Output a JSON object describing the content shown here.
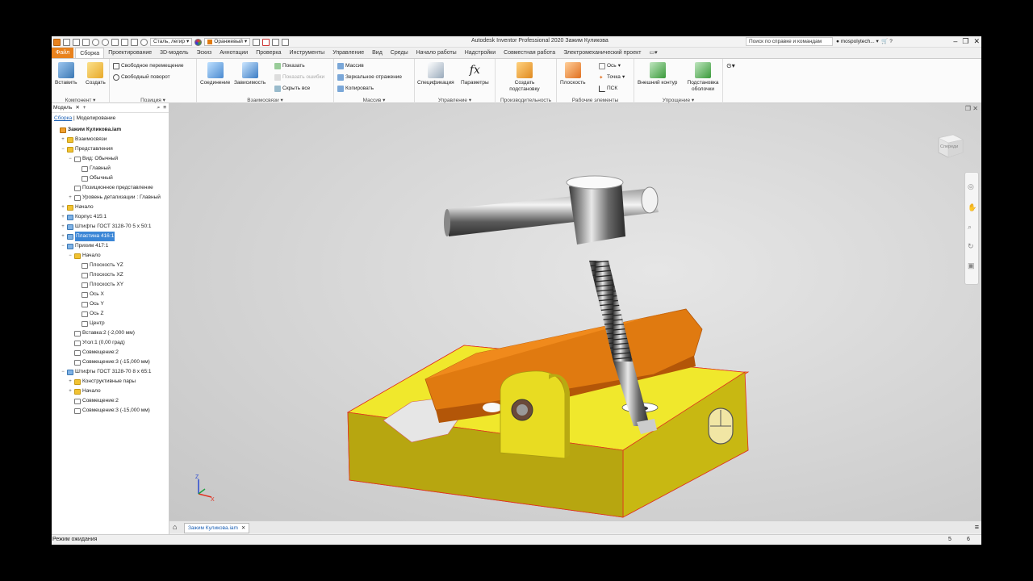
{
  "titlebar": {
    "material": "Сталь, легир",
    "appearance": "Оранжевый",
    "app_title": "Autodesk Inventor Professional 2020   Зажим Куликова",
    "search_placeholder": "Поиск по справке и командам",
    "user": "mospolytech..."
  },
  "tabs": [
    "Сборка",
    "Проектирование",
    "3D-модель",
    "Эскиз",
    "Аннотации",
    "Проверка",
    "Инструменты",
    "Управление",
    "Вид",
    "Среды",
    "Начало работы",
    "Надстройки",
    "Совместная работа",
    "Электромеханический проект"
  ],
  "file_tab": "Файл",
  "ribbon": {
    "component": {
      "label": "Компонент",
      "insert": "Вставить",
      "create": "Создать"
    },
    "position": {
      "label": "Позиция",
      "free_move": "Свободное перемещение",
      "free_rotate": "Свободный поворот"
    },
    "relations": {
      "label": "Взаимосвязи",
      "joint": "Соединение",
      "constraint": "Зависимость",
      "show": "Показать",
      "show_errors": "Показать ошибки",
      "hide_all": "Скрыть все"
    },
    "pattern": {
      "label": "Массив",
      "pattern": "Массив",
      "mirror": "Зеркальное отражение",
      "copy": "Копировать"
    },
    "manage": {
      "label": "Управление",
      "bom": "Спецификация",
      "params": "Параметры"
    },
    "productivity": {
      "label": "Производительность",
      "create_sub": "Создать подстановку"
    },
    "work_features": {
      "label": "Рабочие элементы",
      "plane": "Плоскость",
      "axis": "Ось",
      "point": "Точка",
      "ucs": "ПСК"
    },
    "simplify": {
      "label": "Упрощение",
      "shrinkwrap": "Внешний контур",
      "sub_shell": "Подстановка оболочки"
    }
  },
  "browser": {
    "title": "Модель",
    "crumb_link": "Сборка",
    "crumb_rest": "Моделирование",
    "items": [
      {
        "t": "Зажим Куликова.iam",
        "lvl": 0,
        "icon": "asm",
        "bold": true
      },
      {
        "t": "Взаимосвязи",
        "lvl": 1,
        "icon": "fold",
        "tg": "+"
      },
      {
        "t": "Представления",
        "lvl": 1,
        "icon": "fold",
        "tg": "−"
      },
      {
        "t": "Вид: Обычный",
        "lvl": 2,
        "icon": "gen",
        "tg": "−"
      },
      {
        "t": "Главный",
        "lvl": 3,
        "icon": "gen"
      },
      {
        "t": "Обычный",
        "lvl": 3,
        "icon": "gen"
      },
      {
        "t": "Позиционное представление",
        "lvl": 2,
        "icon": "gen"
      },
      {
        "t": "Уровень детализации : Главный",
        "lvl": 2,
        "icon": "gen",
        "tg": "+"
      },
      {
        "t": "Начало",
        "lvl": 1,
        "icon": "fold",
        "tg": "+"
      },
      {
        "t": "Корпус 415:1",
        "lvl": 1,
        "icon": "part",
        "tg": "+"
      },
      {
        "t": "Штифты ГОСТ 3128-70 5 х  50:1",
        "lvl": 1,
        "icon": "part",
        "tg": "+"
      },
      {
        "t": "Пластина 416:1",
        "lvl": 1,
        "icon": "part",
        "tg": "+",
        "sel": true
      },
      {
        "t": "Прихим 417:1",
        "lvl": 1,
        "icon": "part",
        "tg": "−"
      },
      {
        "t": "Начало",
        "lvl": 2,
        "icon": "fold",
        "tg": "−"
      },
      {
        "t": "Плоскость YZ",
        "lvl": 3,
        "icon": "gen"
      },
      {
        "t": "Плоскость XZ",
        "lvl": 3,
        "icon": "gen"
      },
      {
        "t": "Плоскость XY",
        "lvl": 3,
        "icon": "gen"
      },
      {
        "t": "Ось X",
        "lvl": 3,
        "icon": "gen"
      },
      {
        "t": "Ось Y",
        "lvl": 3,
        "icon": "gen"
      },
      {
        "t": "Ось Z",
        "lvl": 3,
        "icon": "gen"
      },
      {
        "t": "Центр",
        "lvl": 3,
        "icon": "gen"
      },
      {
        "t": "Вставка:2 (-2,000 мм)",
        "lvl": 2,
        "icon": "gen"
      },
      {
        "t": "Угол:1 (0,00 град)",
        "lvl": 2,
        "icon": "gen"
      },
      {
        "t": "Совмещение:2",
        "lvl": 2,
        "icon": "gen"
      },
      {
        "t": "Совмещение:3 (-15,000 мм)",
        "lvl": 2,
        "icon": "gen"
      },
      {
        "t": "Штифты ГОСТ 3128-70 8 х  65:1",
        "lvl": 1,
        "icon": "part",
        "tg": "−"
      },
      {
        "t": "Конструктивные пары",
        "lvl": 2,
        "icon": "fold",
        "tg": "+"
      },
      {
        "t": "Начало",
        "lvl": 2,
        "icon": "fold",
        "tg": "+"
      },
      {
        "t": "Совмещение:2",
        "lvl": 2,
        "icon": "gen"
      },
      {
        "t": "Совмещение:3 (-15,000 мм)",
        "lvl": 2,
        "icon": "gen"
      }
    ]
  },
  "viewcube_label": "Спереди",
  "doc_tab": "Зажим Куликова.iam",
  "status": {
    "text": "Режим ожидания",
    "n1": "5",
    "n2": "6"
  },
  "colors": {
    "file_tab": "#e8821e",
    "part_yellow": "#e0d21a",
    "part_orange": "#e07a10",
    "selection": "#3b86d6"
  }
}
